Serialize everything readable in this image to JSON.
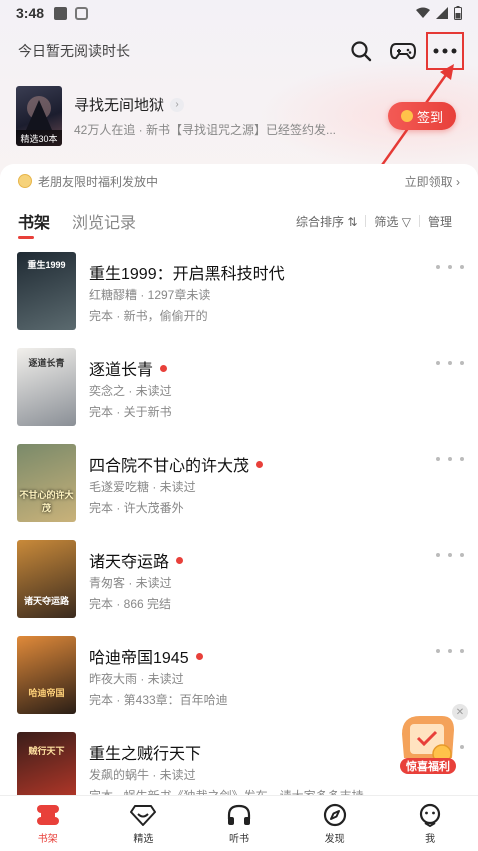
{
  "status_bar": {
    "time": "3:48"
  },
  "header": {
    "reading_time": "今日暂无阅读时长",
    "icons": [
      "search-icon",
      "gamepad-icon",
      "more-icon"
    ]
  },
  "featured": {
    "title": "寻找无间地狱",
    "cover_tag": "精选30本",
    "description": "42万人在追 · 新书【寻找诅咒之源】已经签约发...",
    "checkin_label": "签到"
  },
  "promo": {
    "text": "老朋友限时福利发放中",
    "link": "立即领取"
  },
  "tabs": [
    {
      "label": "书架",
      "active": true
    },
    {
      "label": "浏览记录",
      "active": false
    }
  ],
  "tools": {
    "sort": "综合排序",
    "filter": "筛选",
    "manage": "管理"
  },
  "books": [
    {
      "title": "重生1999：开启黑科技时代",
      "meta": "红糖醪糟 · 1297章未读",
      "status": "完本 · 新书，偷偷开的",
      "has_new": false,
      "cover_text": "重生1999",
      "cover_colors": [
        "#1f2a33",
        "#5b6a6f"
      ]
    },
    {
      "title": "逐道长青",
      "meta": "奕念之 · 未读过",
      "status": "完本 · 关于新书",
      "has_new": true,
      "cover_text": "逐道长青",
      "cover_colors": [
        "#f2f0ec",
        "#8a8f96"
      ]
    },
    {
      "title": "四合院不甘心的许大茂",
      "meta": "毛遂爱吃糖 · 未读过",
      "status": "完本 · 许大茂番外",
      "has_new": true,
      "cover_text": "不甘心的许大茂",
      "cover_colors": [
        "#7a8a6a",
        "#c9b27a"
      ]
    },
    {
      "title": "诸天夺运路",
      "meta": "青匆客 · 未读过",
      "status": "完本 · 866 完结",
      "has_new": true,
      "cover_text": "诸天夺运路",
      "cover_colors": [
        "#c98a3a",
        "#3a2a1e"
      ]
    },
    {
      "title": "哈迪帝国1945",
      "meta": "昨夜大雨 · 未读过",
      "status": "完本 · 第433章：百年哈迪",
      "has_new": true,
      "cover_text": "哈迪帝国",
      "cover_colors": [
        "#e08a3a",
        "#2a1e16"
      ]
    },
    {
      "title": "重生之贼行天下",
      "meta": "发飙的蜗牛 · 未读过",
      "status": "完本 · 蜗牛新书《独裁之剑》发布，请大家多多支持",
      "has_new": false,
      "cover_text": "贼行天下",
      "cover_colors": [
        "#3a1e1a",
        "#c23a2a"
      ]
    }
  ],
  "float_gift": {
    "label": "惊喜福利"
  },
  "bottom_nav": [
    {
      "label": "书架",
      "icon": "bookshelf-icon",
      "active": true
    },
    {
      "label": "精选",
      "icon": "diamond-icon",
      "active": false
    },
    {
      "label": "听书",
      "icon": "headphones-icon",
      "active": false
    },
    {
      "label": "发现",
      "icon": "compass-icon",
      "active": false
    },
    {
      "label": "我",
      "icon": "profile-icon",
      "active": false
    }
  ],
  "colors": {
    "accent": "#e8403a",
    "text": "#222222",
    "muted": "#888888"
  }
}
